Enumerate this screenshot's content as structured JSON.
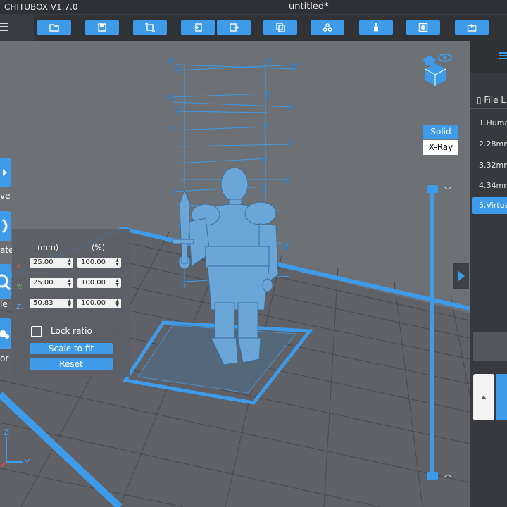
{
  "app_title": "CHITUBOX V1.7.0",
  "document_title": "untitled*",
  "toolbar": {
    "buttons": [
      "open-file-icon",
      "save-icon",
      "auto-layout-icon",
      "import-icon",
      "export-icon",
      "copy-icon",
      "support-icon",
      "hollow-icon",
      "stamp-icon",
      "slice-icon"
    ]
  },
  "left_tools": {
    "move_label": "ve",
    "rotate_label": "ate",
    "scale_label": "le",
    "mirror_label": "or"
  },
  "scale_panel": {
    "mm_header": "(mm)",
    "pct_header": "(%)",
    "x_label": "X:",
    "y_label": "Y:",
    "z_label": "Z:",
    "x_mm": "25.00",
    "x_pct": "100.00",
    "y_mm": "25.00",
    "y_pct": "100.00",
    "z_mm": "50.83",
    "z_pct": "100.00",
    "lock_ratio": "Lock ratio",
    "scale_to_fit": "Scale to fit",
    "reset": "Reset"
  },
  "view_mode": {
    "solid": "Solid",
    "xray": "X-Ray"
  },
  "height_marks": [
    "9'",
    "9'",
    "9'",
    "9'",
    "8'",
    "8'",
    "8'",
    "8'",
    "7'",
    "7'",
    "7'",
    "6'",
    "6'",
    "5'",
    "5'",
    "4'",
    "3'"
  ],
  "sidebar": {
    "file_list_title": "File L",
    "files": [
      "1.Human",
      "2.28mm",
      "3.32mm",
      "4.34mm",
      "5.Virtual"
    ]
  },
  "axes": {
    "x": "X",
    "y": "Y",
    "z": "Z"
  },
  "colors": {
    "accent": "#3d9be9",
    "model": "#6aa6d8"
  }
}
